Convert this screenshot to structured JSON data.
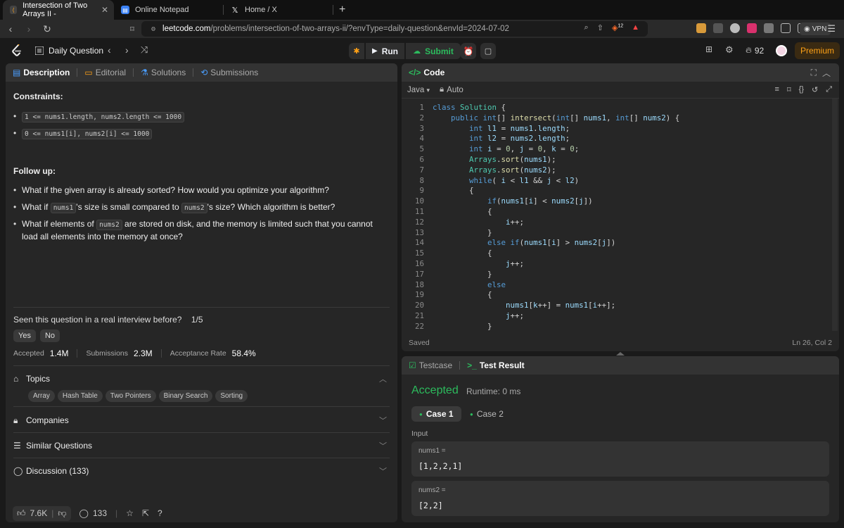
{
  "browser": {
    "tabs": [
      {
        "title": "Intersection of Two Arrays II -",
        "active": true,
        "icon": "leetcode-icon"
      },
      {
        "title": "Online Notepad",
        "active": false,
        "icon": "notepad-icon"
      },
      {
        "title": "Home / X",
        "active": false,
        "icon": "x-icon"
      }
    ],
    "url_host": "leetcode.com",
    "url_path": "/problems/intersection-of-two-arrays-ii/?envType=daily-question&envId=2024-07-02",
    "vpn_label": "VPN",
    "brave_badge": "12"
  },
  "nav": {
    "title": "Daily Question",
    "run_label": "Run",
    "submit_label": "Submit",
    "streak": "92",
    "premium_label": "Premium"
  },
  "left": {
    "tabs": [
      "Description",
      "Editorial",
      "Solutions",
      "Submissions"
    ],
    "constraints_title": "Constraints:",
    "constraints": [
      "1 <= nums1.length, nums2.length <= 1000",
      "0 <= nums1[i], nums2[i] <= 1000"
    ],
    "followup_title": "Follow up:",
    "followups": {
      "q1": "What if the given array is already sorted? How would you optimize your algorithm?",
      "q2_pre": "What if",
      "q2_code1": "nums1",
      "q2_mid": "'s size is small compared to",
      "q2_code2": "nums2",
      "q2_post": "'s size? Which algorithm is better?",
      "q3_pre": "What if elements of",
      "q3_code": "nums2",
      "q3_post": "are stored on disk, and the memory is limited such that you cannot load all elements into the memory at once?"
    },
    "interview_q": "Seen this question in a real interview before?",
    "interview_count": "1/5",
    "yes_label": "Yes",
    "no_label": "No",
    "stats": {
      "accepted_label": "Accepted",
      "accepted": "1.4M",
      "submissions_label": "Submissions",
      "submissions": "2.3M",
      "rate_label": "Acceptance Rate",
      "rate": "58.4%"
    },
    "topics_label": "Topics",
    "topics": [
      "Array",
      "Hash Table",
      "Two Pointers",
      "Binary Search",
      "Sorting"
    ],
    "companies_label": "Companies",
    "similar_label": "Similar Questions",
    "discussion_label": "Discussion (133)",
    "footer": {
      "likes": "7.6K",
      "comments": "133"
    }
  },
  "code": {
    "tab_label": "Code",
    "language": "Java",
    "mode": "Auto",
    "status": "Saved",
    "cursor": "Ln 26, Col 2",
    "lines": [
      "class Solution {",
      "    public int[] intersect(int[] nums1, int[] nums2) {",
      "        int l1 = nums1.length;",
      "        int l2 = nums2.length;",
      "        int i = 0, j = 0, k = 0;",
      "        Arrays.sort(nums1);",
      "        Arrays.sort(nums2);",
      "        while( i < l1 && j < l2)",
      "        {",
      "            if(nums1[i] < nums2[j])",
      "            {",
      "                i++;",
      "            }",
      "            else if(nums1[i] > nums2[j])",
      "            {",
      "                j++;",
      "            }",
      "            else",
      "            {",
      "                nums1[k++] = nums1[i++];",
      "                j++;",
      "            }"
    ]
  },
  "test": {
    "testcase_label": "Testcase",
    "result_label": "Test Result",
    "verdict": "Accepted",
    "runtime": "Runtime: 0 ms",
    "cases": [
      "Case 1",
      "Case 2"
    ],
    "input_label": "Input",
    "inputs": [
      {
        "name": "nums1 =",
        "value": "[1,2,2,1]"
      },
      {
        "name": "nums2 =",
        "value": "[2,2]"
      }
    ]
  }
}
